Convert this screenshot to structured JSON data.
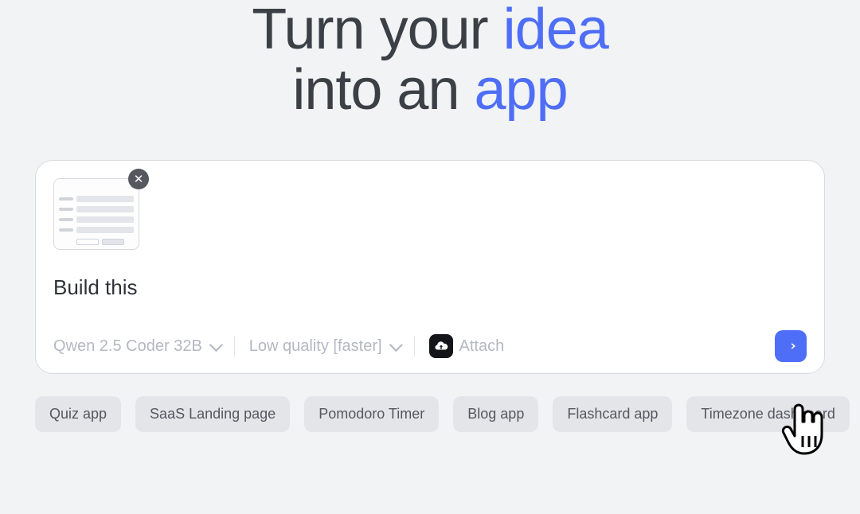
{
  "hero": {
    "line1_pre": "Turn your ",
    "line1_accent": "idea",
    "line2_pre": "into an ",
    "line2_accent": "app"
  },
  "composer": {
    "prompt_text": "Build this",
    "attachment_kind": "form-wireframe",
    "remove_glyph": "✕",
    "model_selector": {
      "label": "Qwen 2.5 Coder 32B"
    },
    "quality_selector": {
      "label": "Low quality [faster]"
    },
    "attach_label": "Attach"
  },
  "suggestions": [
    "Quiz app",
    "SaaS Landing page",
    "Pomodoro Timer",
    "Blog app",
    "Flashcard app",
    "Timezone dashboard"
  ],
  "colors": {
    "accent": "#4f6ef7"
  }
}
